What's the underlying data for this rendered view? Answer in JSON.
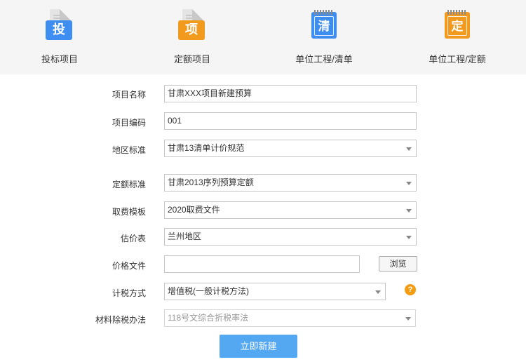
{
  "tabs": [
    {
      "label": "投标项目",
      "icon": "bid-document-icon",
      "glyph": "投",
      "color": "#3d8ef0"
    },
    {
      "label": "定额项目",
      "icon": "quota-document-icon",
      "glyph": "项",
      "color": "#f29a1e"
    },
    {
      "label": "单位工程/清单",
      "icon": "list-notebook-icon",
      "glyph": "清",
      "color": "#3d8ef0"
    },
    {
      "label": "单位工程/定额",
      "icon": "quota-notebook-icon",
      "glyph": "定",
      "color": "#f29a1e"
    }
  ],
  "form": {
    "project_name": {
      "label": "项目名称",
      "value": "甘肃XXX项目新建预算"
    },
    "project_code": {
      "label": "项目编码",
      "value": "001"
    },
    "region_standard": {
      "label": "地区标准",
      "value": "甘肃13清单计价规范"
    },
    "quota_standard": {
      "label": "定额标准",
      "value": "甘肃2013序列预算定额"
    },
    "fee_template": {
      "label": "取费模板",
      "value": "2020取费文件"
    },
    "price_table": {
      "label": "估价表",
      "value": "兰州地区"
    },
    "price_file": {
      "label": "价格文件",
      "value": "",
      "browse_label": "浏览"
    },
    "tax_method": {
      "label": "计税方式",
      "value": "增值税(一般计税方法)",
      "help": "?"
    },
    "material_tax": {
      "label": "材料除税办法",
      "value": "118号文综合折税率法"
    }
  },
  "submit_label": "立即新建"
}
